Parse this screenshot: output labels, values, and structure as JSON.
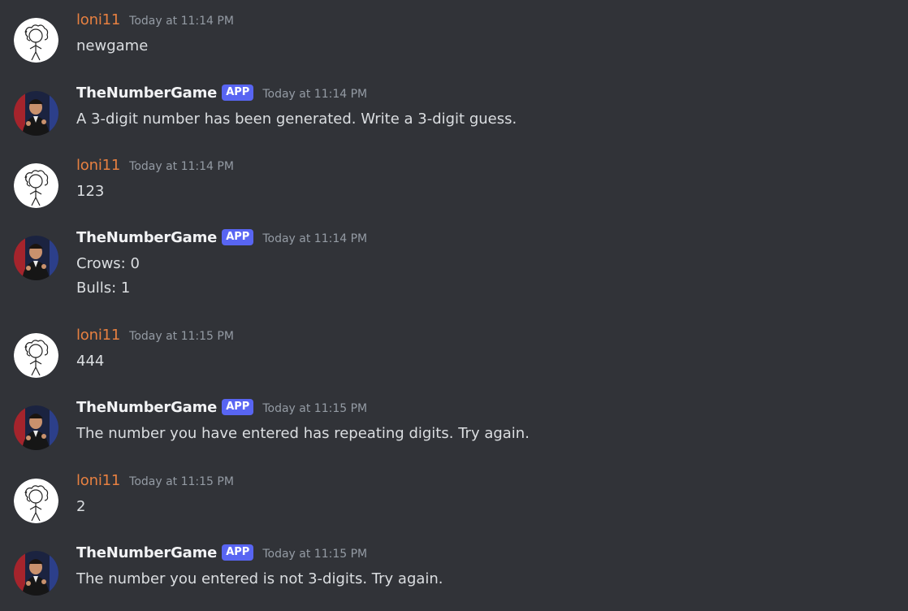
{
  "messages": [
    {
      "author": "loni11",
      "kind": "user",
      "time": "Today at 11:14 PM",
      "lines": [
        "newgame"
      ]
    },
    {
      "author": "TheNumberGame",
      "kind": "bot",
      "badge": "APP",
      "time": "Today at 11:14 PM",
      "lines": [
        "A 3-digit number has been generated. Write a 3-digit guess."
      ]
    },
    {
      "author": "loni11",
      "kind": "user",
      "time": "Today at 11:14 PM",
      "lines": [
        "123"
      ]
    },
    {
      "author": "TheNumberGame",
      "kind": "bot",
      "badge": "APP",
      "time": "Today at 11:14 PM",
      "lines": [
        "Crows: 0",
        "Bulls: 1"
      ]
    },
    {
      "author": "loni11",
      "kind": "user",
      "time": "Today at 11:15 PM",
      "lines": [
        "444"
      ]
    },
    {
      "author": "TheNumberGame",
      "kind": "bot",
      "badge": "APP",
      "time": "Today at 11:15 PM",
      "lines": [
        "The number you have entered has repeating digits. Try again."
      ]
    },
    {
      "author": "loni11",
      "kind": "user",
      "time": "Today at 11:15 PM",
      "lines": [
        "2"
      ]
    },
    {
      "author": "TheNumberGame",
      "kind": "bot",
      "badge": "APP",
      "time": "Today at 11:15 PM",
      "lines": [
        "The number you entered is not 3-digits. Try again."
      ]
    }
  ],
  "colors": {
    "background": "#313338",
    "user_name": "#e78041",
    "bot_name": "#f2f3f5",
    "badge": "#5865f2",
    "timestamp": "#949ba4",
    "message_text": "#dbdee1"
  }
}
